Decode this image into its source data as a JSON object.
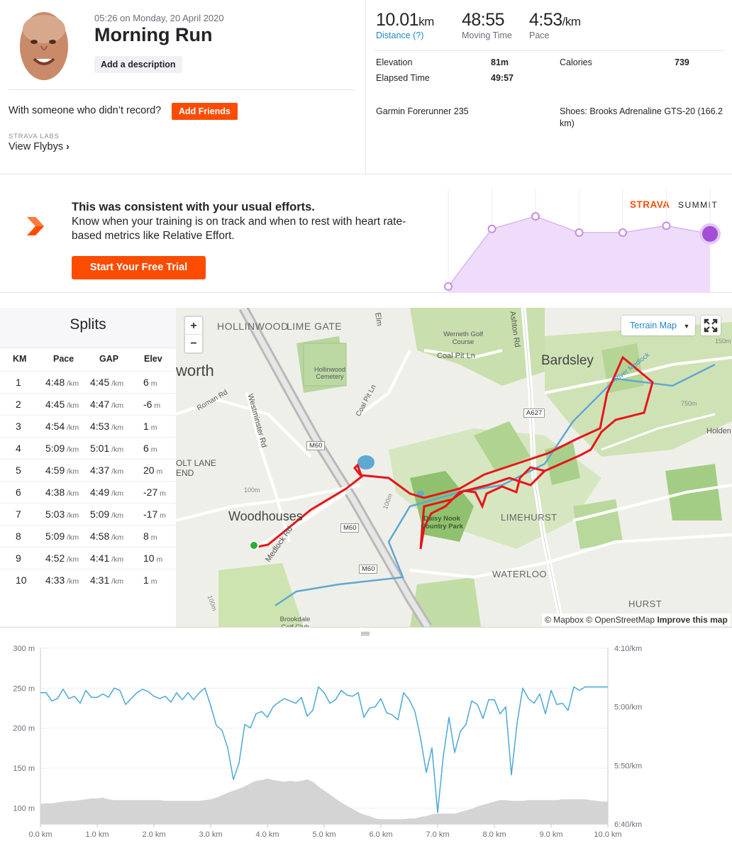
{
  "header": {
    "datetime": "05:26 on Monday, 20 April 2020",
    "title": "Morning Run",
    "add_description": "Add a description",
    "with_someone": "With someone who didn’t record?",
    "add_friends": "Add Friends",
    "labs_label": "STRAVA LABS",
    "view_flybys": "View Flybys"
  },
  "stats": {
    "distance": {
      "value": "10.01",
      "unit": "km",
      "label": "Distance (?)"
    },
    "moving_time": {
      "value": "48:55",
      "label": "Moving Time"
    },
    "pace": {
      "value": "4:53",
      "unit": "/km",
      "label": "Pace"
    },
    "elevation": {
      "label": "Elevation",
      "value": "81m"
    },
    "calories": {
      "label": "Calories",
      "value": "739"
    },
    "elapsed": {
      "label": "Elapsed Time",
      "value": "49:57"
    },
    "device": "Garmin Forerunner 235",
    "shoes": "Shoes: Brooks Adrenaline GTS-20 (166.2 km)"
  },
  "promo": {
    "title": "This was consistent with your usual efforts.",
    "text": "Know when your training is on track and when to rest with heart rate-based metrics like Relative Effort.",
    "button": "Start Your Free Trial",
    "brand": "STRAVA",
    "tier": "SUMMIT",
    "effort_levels": [
      0.0,
      0.92,
      1.12,
      0.86,
      0.86,
      0.97,
      0.84
    ]
  },
  "splits": {
    "title": "Splits",
    "columns": [
      "KM",
      "Pace",
      "GAP",
      "Elev"
    ],
    "pace_unit": "/km",
    "elev_unit": "m",
    "rows": [
      {
        "km": "1",
        "pace": "4:48",
        "gap": "4:45",
        "elev": "6"
      },
      {
        "km": "2",
        "pace": "4:45",
        "gap": "4:47",
        "elev": "-6"
      },
      {
        "km": "3",
        "pace": "4:54",
        "gap": "4:53",
        "elev": "1"
      },
      {
        "km": "4",
        "pace": "5:09",
        "gap": "5:01",
        "elev": "6"
      },
      {
        "km": "5",
        "pace": "4:59",
        "gap": "4:37",
        "elev": "20"
      },
      {
        "km": "6",
        "pace": "4:38",
        "gap": "4:49",
        "elev": "-27"
      },
      {
        "km": "7",
        "pace": "5:03",
        "gap": "5:09",
        "elev": "-17"
      },
      {
        "km": "8",
        "pace": "5:09",
        "gap": "4:58",
        "elev": "8"
      },
      {
        "km": "9",
        "pace": "4:52",
        "gap": "4:41",
        "elev": "10"
      },
      {
        "km": "10",
        "pace": "4:33",
        "gap": "4:31",
        "elev": "1"
      }
    ]
  },
  "map": {
    "terrain_label": "Terrain Map",
    "zoom_in": "+",
    "zoom_out": "−",
    "attribution_prefix": "© Mapbox © OpenStreetMap",
    "attribution_link": "Improve this map",
    "labels": {
      "hollinwood": "HOLLINWOOD",
      "lime_gate": "LIME GATE",
      "worth": "worth",
      "hollinwood_cemetery": "Hollinwood Cemetery",
      "werneth_golf": "Werneth Golf Course",
      "coal_pit_ln": "Coal Pit Ln",
      "coal_pit_ln_2": "Coal Pit Ln",
      "ashton_rd": "Ashton Rd",
      "elm": "Elm",
      "bardsley": "Bardsley",
      "roman_rd": "Roman Rd",
      "westminster_rd": "Westminster Rd",
      "m60_a": "M60",
      "m60_b": "M60",
      "m60_c": "M60",
      "a627": "A627",
      "river_medlock": "River Medlock",
      "olt_lane_end": "OLT LANE END",
      "holden": "Holden",
      "woodhouses": "Woodhouses",
      "medlock_rd": "Medlock Rd",
      "daisy_nook": "Daisy Nook Country Park",
      "limehurst": "LIMEHURST",
      "waterloo": "WATERLOO",
      "hurst": "HURST",
      "brookdale": "Brookdale Golf Club",
      "c100m_a": "100m",
      "c100m_b": "100m",
      "c100m_c": "100m",
      "c150m": "150m",
      "c750m": "750m"
    }
  },
  "chart_data": {
    "type": "line",
    "x": [
      0,
      0.1,
      0.2,
      0.3,
      0.4,
      0.5,
      0.6,
      0.7,
      0.8,
      0.9,
      1.0,
      1.1,
      1.2,
      1.3,
      1.4,
      1.5,
      1.6,
      1.7,
      1.8,
      1.9,
      2.0,
      2.1,
      2.2,
      2.3,
      2.4,
      2.5,
      2.6,
      2.7,
      2.8,
      2.9,
      3.0,
      3.1,
      3.2,
      3.3,
      3.4,
      3.5,
      3.6,
      3.7,
      3.8,
      3.9,
      4.0,
      4.1,
      4.2,
      4.3,
      4.4,
      4.5,
      4.6,
      4.7,
      4.8,
      4.9,
      5.0,
      5.1,
      5.2,
      5.3,
      5.4,
      5.5,
      5.6,
      5.7,
      5.8,
      5.9,
      6.0,
      6.1,
      6.2,
      6.3,
      6.4,
      6.5,
      6.6,
      6.7,
      6.8,
      6.9,
      7.0,
      7.1,
      7.2,
      7.3,
      7.4,
      7.5,
      7.6,
      7.7,
      7.8,
      7.9,
      8.0,
      8.1,
      8.2,
      8.3,
      8.4,
      8.5,
      8.6,
      8.7,
      8.8,
      8.9,
      9.0,
      9.1,
      9.2,
      9.3,
      9.4,
      9.5,
      9.6,
      9.7,
      9.8,
      9.9,
      10.0
    ],
    "xlim": [
      0,
      10.0
    ],
    "x_ticks": [
      "0.0 km",
      "1.0 km",
      "2.0 km",
      "3.0 km",
      "4.0 km",
      "5.0 km",
      "6.0 km",
      "7.0 km",
      "8.0 km",
      "9.0 km",
      "10.0 km"
    ],
    "y_left_ticks": [
      "100 m",
      "150 m",
      "200 m",
      "250 m",
      "300 m"
    ],
    "y_right_ticks": [
      "4:10/km",
      "5:00/km",
      "5:50/km",
      "6:40/km"
    ],
    "ylim_left": [
      80,
      300
    ],
    "ylim_right_sec_per_km": [
      250,
      400
    ],
    "series": [
      {
        "kind": "area",
        "axis": "left",
        "color": "#d4d4d4",
        "values": [
          105,
          106,
          106,
          107,
          108,
          109,
          109,
          110,
          111,
          112,
          112,
          113,
          111,
          110,
          110,
          110,
          110,
          110,
          110,
          110,
          110,
          110,
          109,
          109,
          109,
          109,
          109,
          109,
          109,
          110,
          111,
          113,
          116,
          119,
          122,
          124,
          127,
          131,
          134,
          135,
          137,
          135,
          134,
          133,
          134,
          133,
          134,
          136,
          133,
          127,
          122,
          117,
          112,
          107,
          103,
          99,
          95,
          92,
          90,
          87,
          86,
          86,
          86,
          86,
          86,
          87,
          87,
          89,
          90,
          92,
          93,
          93,
          93,
          93,
          95,
          97,
          99,
          102,
          104,
          106,
          108,
          110,
          110,
          109,
          109,
          109,
          110,
          110,
          110,
          110,
          110,
          110,
          111,
          111,
          111,
          111,
          111,
          110,
          109,
          108,
          108
        ]
      },
      {
        "kind": "line",
        "axis": "right",
        "color": "#4aa8d8",
        "values": [
          288,
          288,
          295,
          293,
          285,
          293,
          291,
          297,
          286,
          292,
          292,
          289,
          292,
          284,
          286,
          298,
          293,
          288,
          285,
          287,
          291,
          293,
          291,
          296,
          288,
          294,
          288,
          294,
          288,
          284,
          299,
          316,
          320,
          335,
          362,
          348,
          315,
          318,
          306,
          304,
          309,
          300,
          296,
          293,
          295,
          297,
          292,
          308,
          303,
          283,
          288,
          297,
          294,
          286,
          290,
          291,
          288,
          309,
          301,
          300,
          293,
          305,
          307,
          311,
          288,
          294,
          304,
          327,
          356,
          335,
          390,
          342,
          309,
          339,
          321,
          315,
          295,
          298,
          310,
          294,
          294,
          306,
          300,
          358,
          314,
          284,
          293,
          297,
          289,
          306,
          286,
          298,
          297,
          303,
          283,
          286,
          283,
          283,
          283,
          283,
          283
        ]
      }
    ]
  }
}
